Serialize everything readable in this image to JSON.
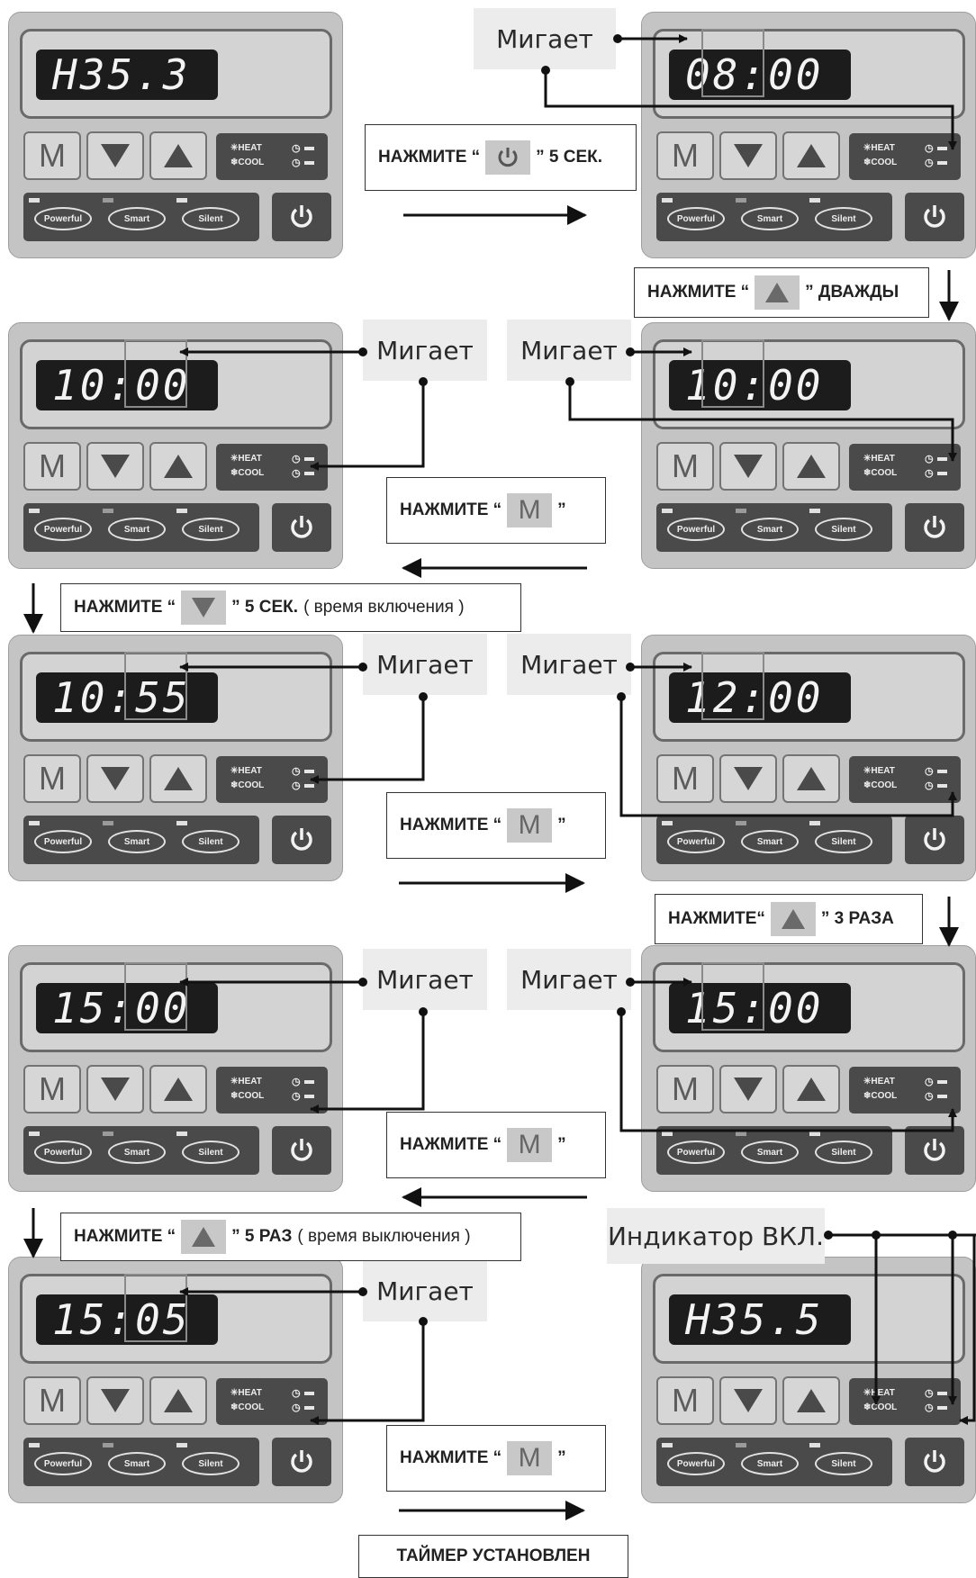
{
  "panel_labels": {
    "m": "M",
    "heat": "✳HEAT",
    "cool": "❄COOL",
    "powerful": "Powerful",
    "smart": "Smart",
    "silent": "Silent"
  },
  "panels": [
    {
      "id": "p1",
      "display": "H35.3"
    },
    {
      "id": "p2",
      "display": "08:00"
    },
    {
      "id": "p3",
      "display": "10:00"
    },
    {
      "id": "p4",
      "display": "10:00"
    },
    {
      "id": "p5",
      "display": "10:55"
    },
    {
      "id": "p6",
      "display": "12:00"
    },
    {
      "id": "p7",
      "display": "15:00"
    },
    {
      "id": "p8",
      "display": "15:00"
    },
    {
      "id": "p9",
      "display": "15:05"
    },
    {
      "id": "p10",
      "display": "H35.5"
    }
  ],
  "blink_label": "Мигает",
  "indicator_label": "Индикатор ВКЛ.",
  "instructions": {
    "power5": {
      "pre": "НАЖМИТЕ “",
      "post": "” 5 СЕК."
    },
    "up2": {
      "pre": "НАЖМИТЕ “",
      "post": "” ДВАЖДЫ"
    },
    "m": {
      "pre": "НАЖМИТЕ “",
      "post": "”"
    },
    "down5": {
      "pre": "НАЖМИТЕ “",
      "post": "” 5 СЕК.",
      "note": "( время включения )"
    },
    "up3": {
      "pre": "НАЖМИТЕ“",
      "post": "” 3 РАЗА"
    },
    "up5": {
      "pre": "НАЖМИТЕ “",
      "post": "” 5 РАЗ",
      "note": "( время выключения )"
    }
  },
  "final_label": "ТАЙМЕР УСТАНОВЛЕН"
}
